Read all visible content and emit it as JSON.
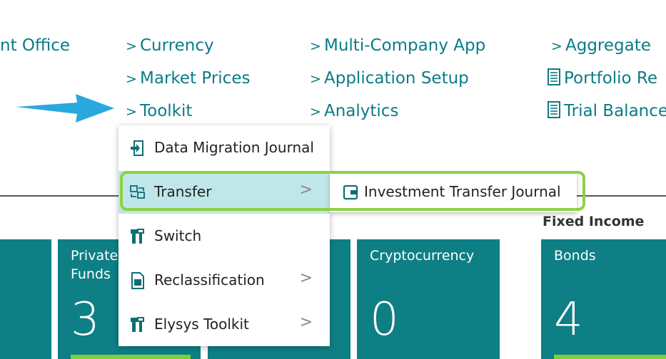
{
  "nav": {
    "col0": {
      "item0": "nt Office"
    },
    "col1": {
      "items": [
        "Currency",
        "Market Prices",
        "Toolkit"
      ]
    },
    "col2": {
      "items": [
        "Multi-Company App",
        "Application Setup",
        "Analytics"
      ]
    },
    "col3": {
      "items": [
        "Aggregate",
        "Portfolio Re",
        "Trial Balance"
      ]
    },
    "chevron": ">"
  },
  "tiles": [
    {
      "title": "Private Funds",
      "title_line1": "Private",
      "title_line2": "Funds",
      "value": "3"
    },
    {
      "title": "Cryptocurrency",
      "value": "0"
    },
    {
      "title": "Bonds",
      "value": "4"
    }
  ],
  "section": {
    "fixed_income": "Fixed Income"
  },
  "menu": {
    "items": [
      {
        "label": "Data Migration Journal",
        "icon": "journal-icon",
        "has_submenu": false
      },
      {
        "label": "Transfer",
        "icon": "transfer-icon",
        "has_submenu": true,
        "active": true
      },
      {
        "label": "Switch",
        "icon": "tools-icon",
        "has_submenu": false
      },
      {
        "label": "Reclassification",
        "icon": "document-icon",
        "has_submenu": true
      },
      {
        "label": "Elysys Toolkit",
        "icon": "tools-icon",
        "has_submenu": true
      }
    ],
    "submenu_chevron": ">"
  },
  "submenu": {
    "items": [
      {
        "label": "Investment Transfer Journal",
        "icon": "wallet-icon"
      }
    ]
  },
  "colors": {
    "accent": "#0a7c86",
    "tile": "#0e7f85",
    "highlight": "#8dd144",
    "active": "#bfe6e8",
    "arrow": "#29a8e0"
  }
}
